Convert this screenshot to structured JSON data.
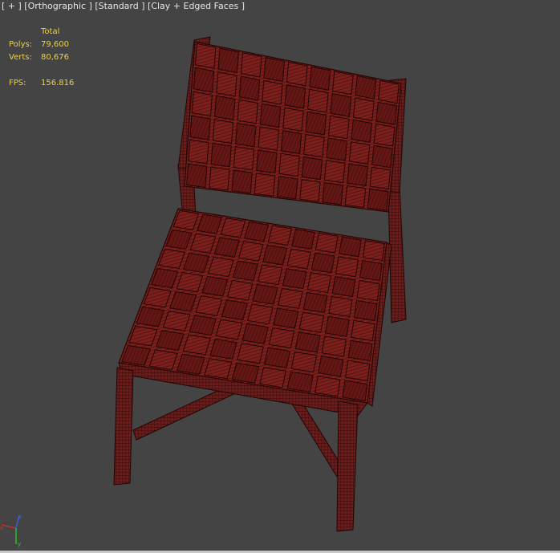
{
  "viewport": {
    "menu": "[ + ]",
    "view": "[Orthographic ]",
    "shading": "[Standard ]",
    "style": "[Clay + Edged Faces ]"
  },
  "stats": {
    "header": "Total",
    "polys_label": "Polys:",
    "polys_value": "79,600",
    "verts_label": "Verts:",
    "verts_value": "80,676",
    "fps_label": "FPS:",
    "fps_value": "156.816"
  },
  "colors": {
    "background": "#444444",
    "stats_text": "#e8d24a",
    "mesh_fill": "#6e1a18",
    "mesh_wire": "#2a0705",
    "axis_x": "#d42a2a",
    "axis_y": "#2ec82e",
    "axis_z": "#3a5ee8"
  },
  "object": {
    "name": "chair-model"
  },
  "axis_gizmo": {
    "x": "x",
    "y": "y",
    "z": "z"
  }
}
